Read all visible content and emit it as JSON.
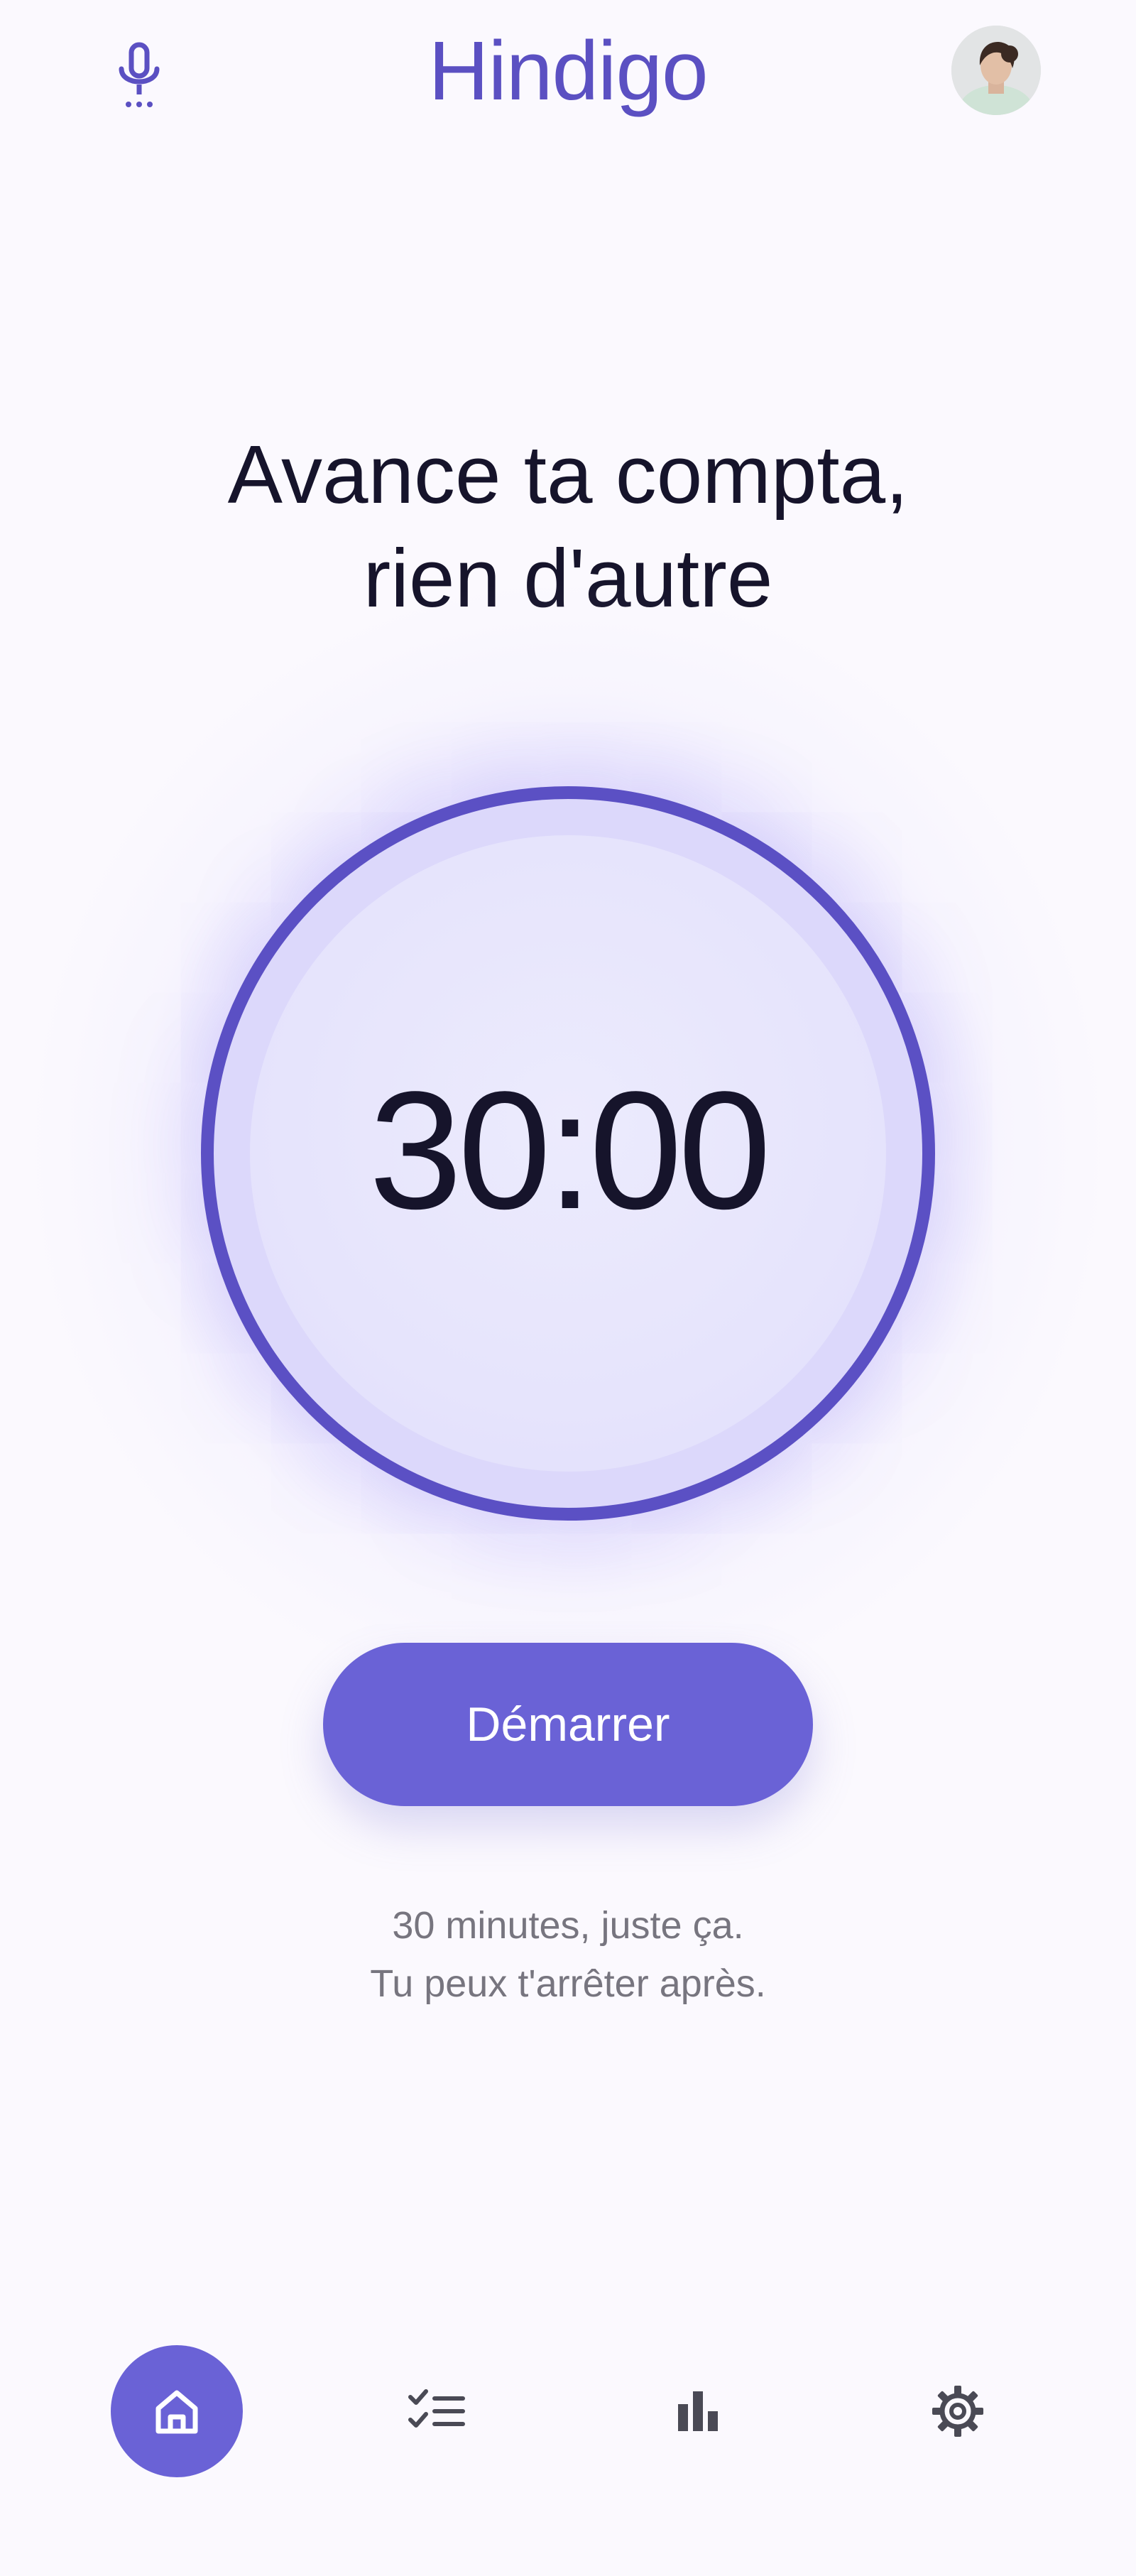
{
  "header": {
    "app_title": "Hindigo",
    "mic_icon": "microphone-icon",
    "avatar_icon": "user-avatar"
  },
  "main": {
    "headline_line1": "Avance ta compta,",
    "headline_line2": "rien d'autre",
    "timer_value": "30:00",
    "start_label": "Démarrer",
    "caption_line1": "30 minutes, juste ça.",
    "caption_line2": "Tu peux t'arrêter après."
  },
  "nav": {
    "items": [
      {
        "icon": "home-icon",
        "active": true
      },
      {
        "icon": "checklist-icon",
        "active": false
      },
      {
        "icon": "bar-chart-icon",
        "active": false
      },
      {
        "icon": "settings-gear-icon",
        "active": false
      }
    ]
  },
  "colors": {
    "accent": "#5b50c4",
    "button": "#6a62d6",
    "background": "#fbf9fe",
    "text_dark": "#16142b",
    "text_muted": "#77757f"
  }
}
